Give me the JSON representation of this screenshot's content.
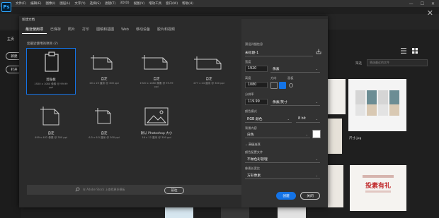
{
  "app": {
    "logo_text": "Ps",
    "menu": [
      "文件(F)",
      "编辑(E)",
      "图像(I)",
      "图层(L)",
      "文字(Y)",
      "选择(S)",
      "滤镜(T)",
      "3D(D)",
      "视图(V)",
      "增效工具",
      "窗口(W)",
      "帮助(H)"
    ],
    "win_min": "—",
    "win_max": "☐",
    "win_close": "✕"
  },
  "home": {
    "tab_label": "主页",
    "new_button": "新建",
    "open_button": "打开",
    "filter_label": "筛选",
    "filter_placeholder": "筛选最近的文件",
    "recent_file_label": "尺寸.jpg",
    "promo_title": "投素有礼"
  },
  "dialog": {
    "title": "新建文档",
    "tabs": [
      "最近使用项",
      "已保存",
      "照片",
      "打印",
      "图稿和插图",
      "Web",
      "移动设备",
      "胶片和视频"
    ],
    "active_tab_index": 0,
    "recent_header": "您最近使用的项目 (7)",
    "presets": [
      {
        "name": "剪贴板",
        "dim1": "1920 x 1080 像素 @ 99.99",
        "dim2": "ppi",
        "icon": "clipboard-icon"
      },
      {
        "name": "自定",
        "dim1": "20 x 25 厘米 @ 300 ppi",
        "dim2": "",
        "icon": "custom-doc-icon"
      },
      {
        "name": "自定",
        "dim1": "1920 x 1080 像素 @ 99.99",
        "dim2": "ppi",
        "icon": "custom-doc-icon"
      },
      {
        "name": "自定",
        "dim1": "277 x 24 厘米 @ 300 ppi",
        "dim2": "",
        "icon": "custom-doc-icon"
      },
      {
        "name": "自定",
        "dim1": "499 x 402 像素 @ 300 ppi",
        "dim2": "",
        "icon": "custom-doc-icon"
      },
      {
        "name": "自定",
        "dim1": "6.5 x 6.5 厘米 @ 300 ppi",
        "dim2": "",
        "icon": "custom-doc-icon"
      },
      {
        "name": "默认 Photoshop 大小",
        "dim1": "16 x 12 厘米 @ 300 ppi",
        "dim2": "",
        "icon": "image-icon"
      }
    ],
    "stock_placeholder": "在 Adobe Stock 上查找更多模板",
    "go_button": "前往",
    "create_button": "创建",
    "close_button": "关闭"
  },
  "details": {
    "section_title": "预设详细信息",
    "doc_name": "未标题-1",
    "width_label": "宽度",
    "width_value": "1920",
    "width_unit": "像素",
    "height_label": "高度",
    "orientation_label": "方向",
    "artboard_label": "画板",
    "height_value": "1080",
    "resolution_label": "分辨率",
    "resolution_value": "119.99",
    "resolution_unit": "像素/英寸",
    "color_mode_label": "颜色模式",
    "color_mode_value": "RGB 颜色",
    "bit_depth": "8 bit",
    "bg_label": "背景内容",
    "bg_value": "白色",
    "bg_color": "#ffffff",
    "advanced_label": "高级选项",
    "profile_label": "颜色配置文件",
    "profile_value": "不做色彩管理",
    "pixel_ratio_label": "像素长宽比",
    "pixel_ratio_value": "方形像素"
  },
  "colors": {
    "accent": "#1473e6",
    "dialog_bg": "#2b2b2b",
    "panel_bg": "#323232"
  }
}
